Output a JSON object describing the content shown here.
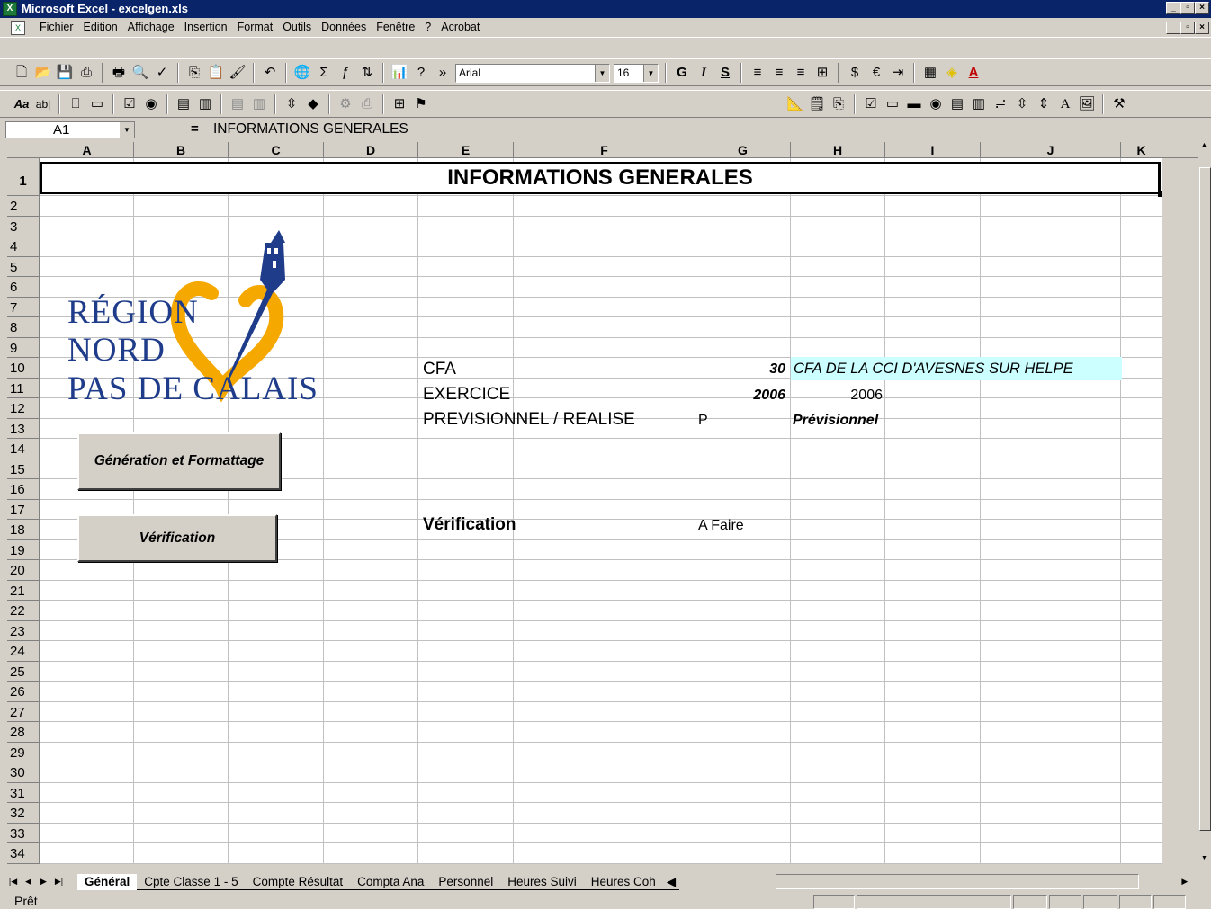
{
  "window": {
    "title": "Microsoft Excel - excelgen.xls",
    "controls": [
      "_",
      "▫",
      "×"
    ]
  },
  "menu": {
    "items": [
      "Fichier",
      "Edition",
      "Affichage",
      "Insertion",
      "Format",
      "Outils",
      "Données",
      "Fenêtre",
      "?",
      "Acrobat"
    ]
  },
  "toolbar": {
    "font": "Arial",
    "size": "16"
  },
  "formula_bar": {
    "name_box": "A1",
    "equals": "=",
    "content": "INFORMATIONS GENERALES"
  },
  "sheet": {
    "columns": [
      "A",
      "B",
      "C",
      "D",
      "E",
      "F",
      "G",
      "H",
      "I",
      "J",
      "K"
    ],
    "rows": [
      "1",
      "2",
      "3",
      "4",
      "5",
      "6",
      "7",
      "8",
      "9",
      "10",
      "11",
      "12",
      "13",
      "14",
      "15",
      "16",
      "17",
      "18",
      "19",
      "20",
      "21",
      "22",
      "23",
      "24",
      "25",
      "26",
      "27",
      "28",
      "29",
      "30",
      "31",
      "32",
      "33",
      "34"
    ],
    "title": "INFORMATIONS GENERALES",
    "logo": {
      "line1": "RÉGION",
      "line2": "NORD",
      "line3": "PAS DE CALAIS",
      "color": "#1f3c8a",
      "accent": "#f5a800"
    },
    "labels": {
      "cfa": "CFA",
      "exercice": "EXERCICE",
      "prev_real": "PREVISIONNEL / REALISE",
      "verification": "Vérification"
    },
    "values": {
      "cfa_code": "30",
      "cfa_name": "CFA DE LA CCI D'AVESNES SUR HELPE",
      "exercice_g": "2006",
      "exercice_h": "2006",
      "prev_code": "P",
      "prev_text": "Prévisionnel",
      "verification_status": "A Faire"
    },
    "highlight_color": "#ccffff"
  },
  "buttons": {
    "generation": "Génération et Formattage",
    "verification": "Vérification"
  },
  "tabs": [
    "Général",
    "Cpte Classe 1 - 5",
    "Compte Résultat",
    "Compta Ana",
    "Personnel",
    "Heures Suivi",
    "Heures Coh"
  ],
  "active_tab": "Général",
  "status": "Prêt"
}
